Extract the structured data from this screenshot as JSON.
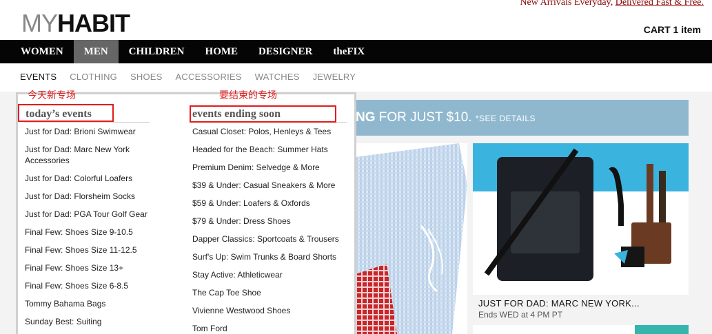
{
  "header": {
    "promo_lead": "New Arrivals Everyday,",
    "promo_link": "Delivered Fast & Free.",
    "logo_my": "MY",
    "logo_habit": "HABIT",
    "cart": "CART 1 item"
  },
  "main_nav": [
    "WOMEN",
    "MEN",
    "CHILDREN",
    "HOME",
    "DESIGNER",
    "theFIX"
  ],
  "sub_nav": [
    "EVENTS",
    "CLOTHING",
    "SHOES",
    "ACCESSORIES",
    "WATCHES",
    "JEWELRY"
  ],
  "banner": {
    "bold": "NG",
    "text": " FOR JUST $10. ",
    "small": "*SEE DETAILS"
  },
  "product": {
    "title": "JUST FOR DAD: MARC NEW YORK...",
    "subtitle": "Ends WED at 4 PM PT"
  },
  "dropdown": {
    "left_note": "今天新专场",
    "right_note": "要结束的专场",
    "today_heading": "today’s events",
    "ending_heading": "events ending soon",
    "today_events": [
      "Just for Dad: Brioni Swimwear",
      "Just for Dad: Marc New York Accessories",
      "Just for Dad: Colorful Loafers",
      "Just for Dad: Florsheim Socks",
      "Just for Dad: PGA Tour Golf Gear",
      "Final Few: Shoes Size 9-10.5",
      "Final Few: Shoes Size 11-12.5",
      "Final Few: Shoes Size 13+",
      "Final Few: Shoes Size 6-8.5",
      "Tommy Bahama Bags",
      "Sunday Best: Suiting"
    ],
    "ending_events": [
      "Casual Closet: Polos, Henleys & Tees",
      "Headed for the Beach: Summer Hats",
      "Premium Denim: Selvedge & More",
      "$39 & Under: Casual Sneakers & More",
      "$59 & Under: Loafers & Oxfords",
      "$79 & Under: Dress Shoes",
      "Dapper Classics: Sportcoats & Trousers",
      "Surf's Up: Swim Trunks & Board Shorts",
      "Stay Active: Athleticwear",
      "The Cap Toe Shoe",
      "Vivienne Westwood Shoes",
      "Tom Ford"
    ]
  },
  "colors": {
    "nav_bg": "#050505",
    "nav_active": "#666666",
    "annotation_red": "#e21b1b",
    "banner_blue": "#8fb8cf",
    "promo_red": "#8b0000"
  }
}
